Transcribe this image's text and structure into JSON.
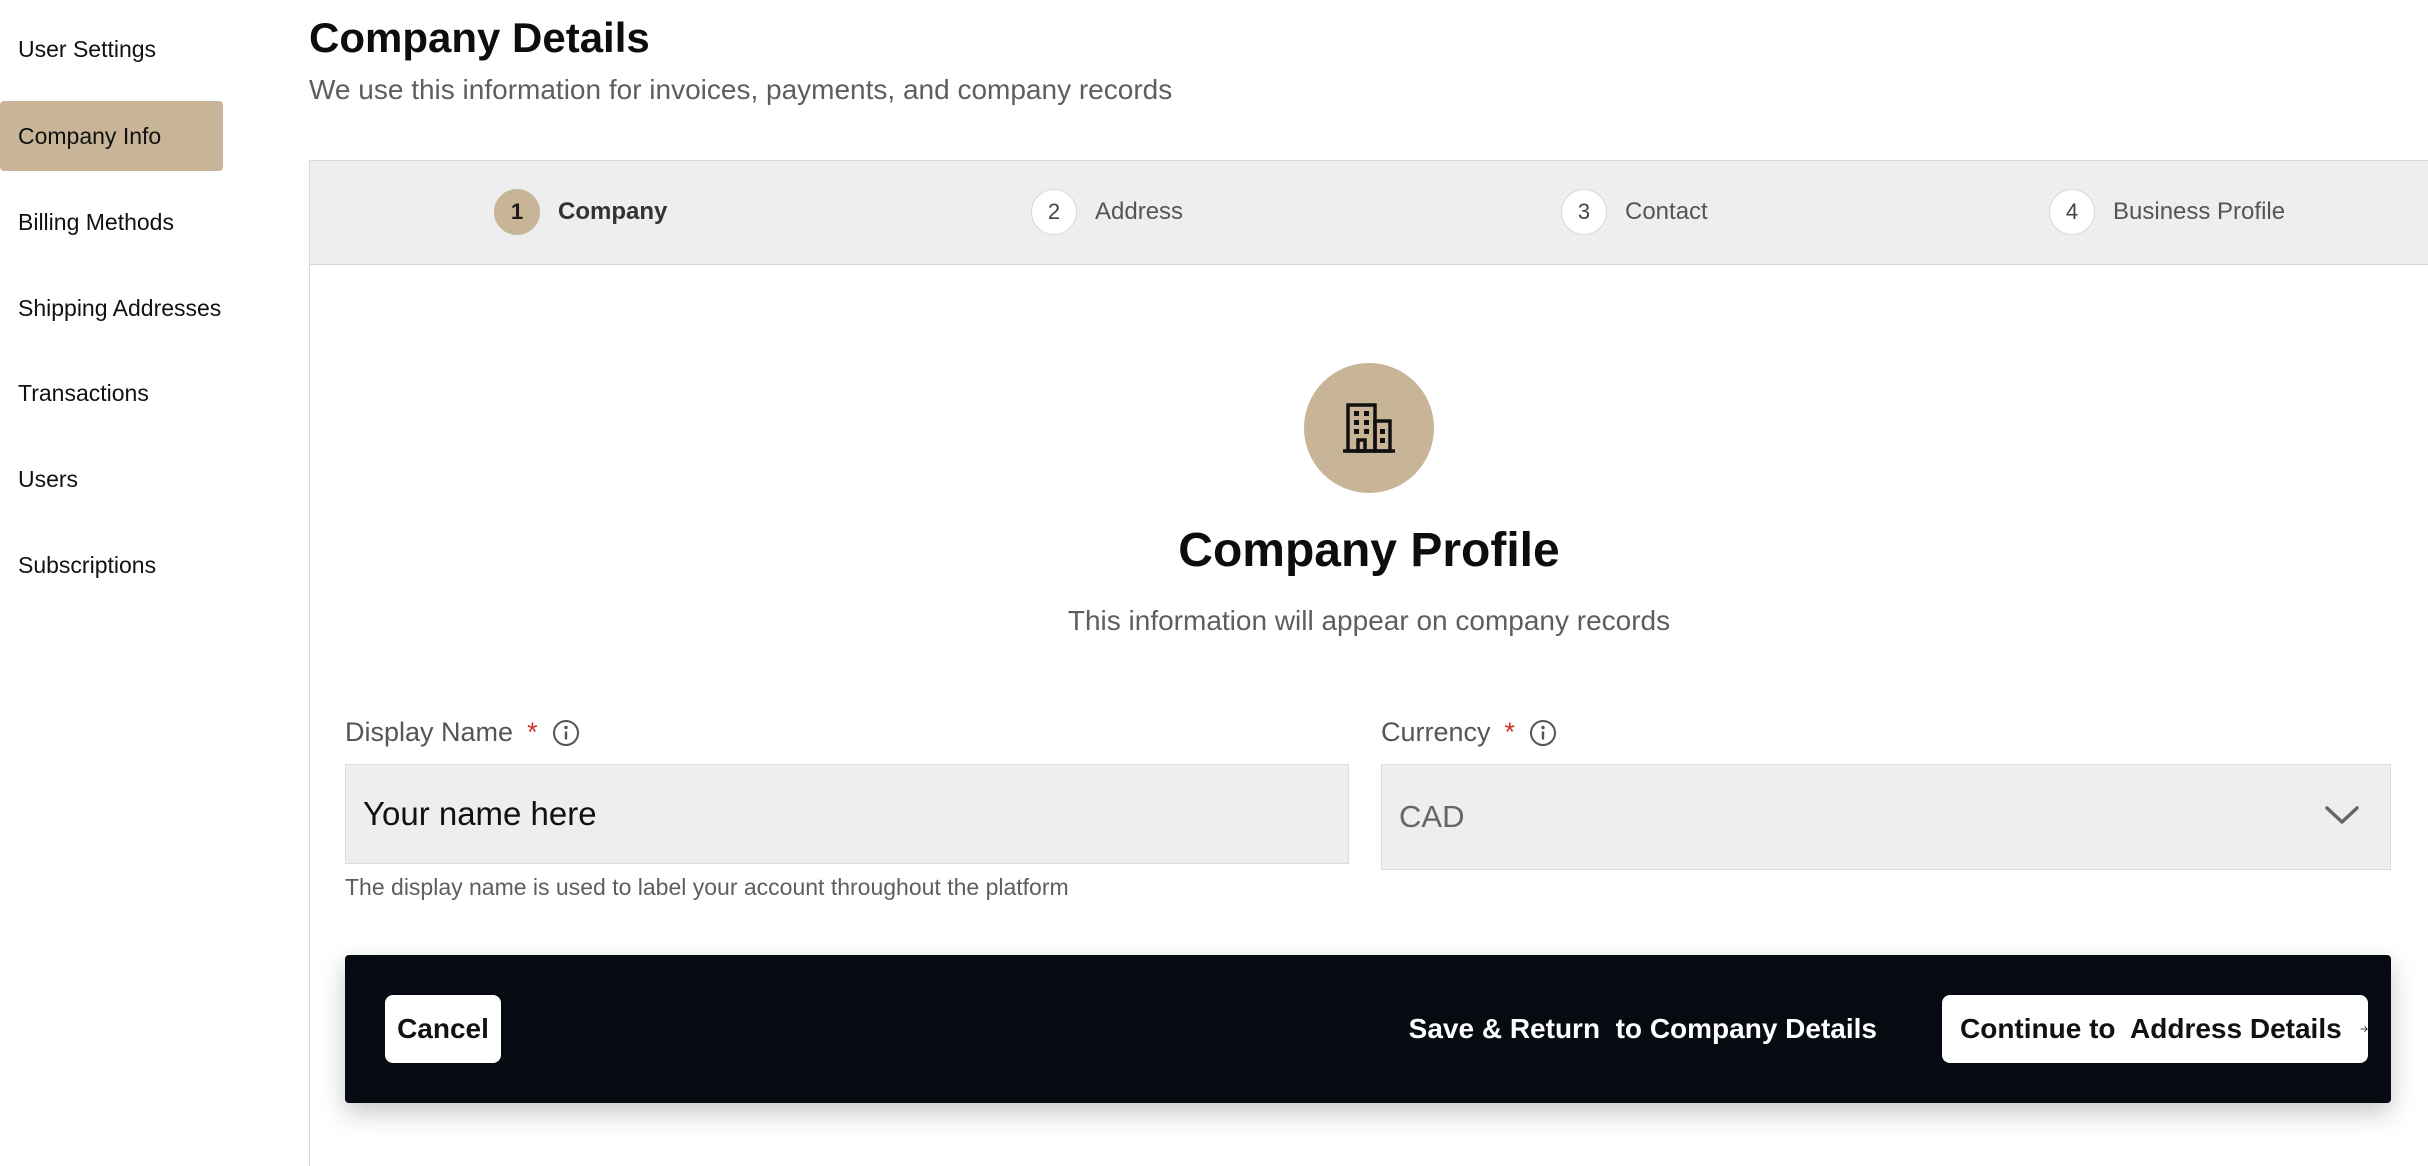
{
  "sidebar": {
    "items": [
      {
        "label": "User Settings"
      },
      {
        "label": "Company Info",
        "active": true
      },
      {
        "label": "Billing Methods"
      },
      {
        "label": "Shipping Addresses"
      },
      {
        "label": "Transactions"
      },
      {
        "label": "Users"
      },
      {
        "label": "Subscriptions"
      }
    ]
  },
  "header": {
    "title": "Company Details",
    "subtitle": "We use this information for invoices, payments, and company records"
  },
  "stepper": {
    "steps": [
      {
        "number": "1",
        "label": "Company",
        "active": true
      },
      {
        "number": "2",
        "label": "Address"
      },
      {
        "number": "3",
        "label": "Contact"
      },
      {
        "number": "4",
        "label": "Business Profile"
      }
    ]
  },
  "profile": {
    "icon": "building-icon",
    "title": "Company Profile",
    "subtitle": "This information will appear on company records"
  },
  "form": {
    "display_name": {
      "label": "Display Name",
      "required_mark": "*",
      "value": "Your name here",
      "help": "The display name is used to label your account throughout the platform"
    },
    "currency": {
      "label": "Currency",
      "required_mark": "*",
      "value": "CAD"
    }
  },
  "actions": {
    "cancel": "Cancel",
    "save_return": "Save & Return  to Company Details",
    "continue": "Continue to  Address Details"
  },
  "colors": {
    "accent": "#c8b496",
    "action_bar": "#060b12",
    "required": "#d0312d"
  }
}
